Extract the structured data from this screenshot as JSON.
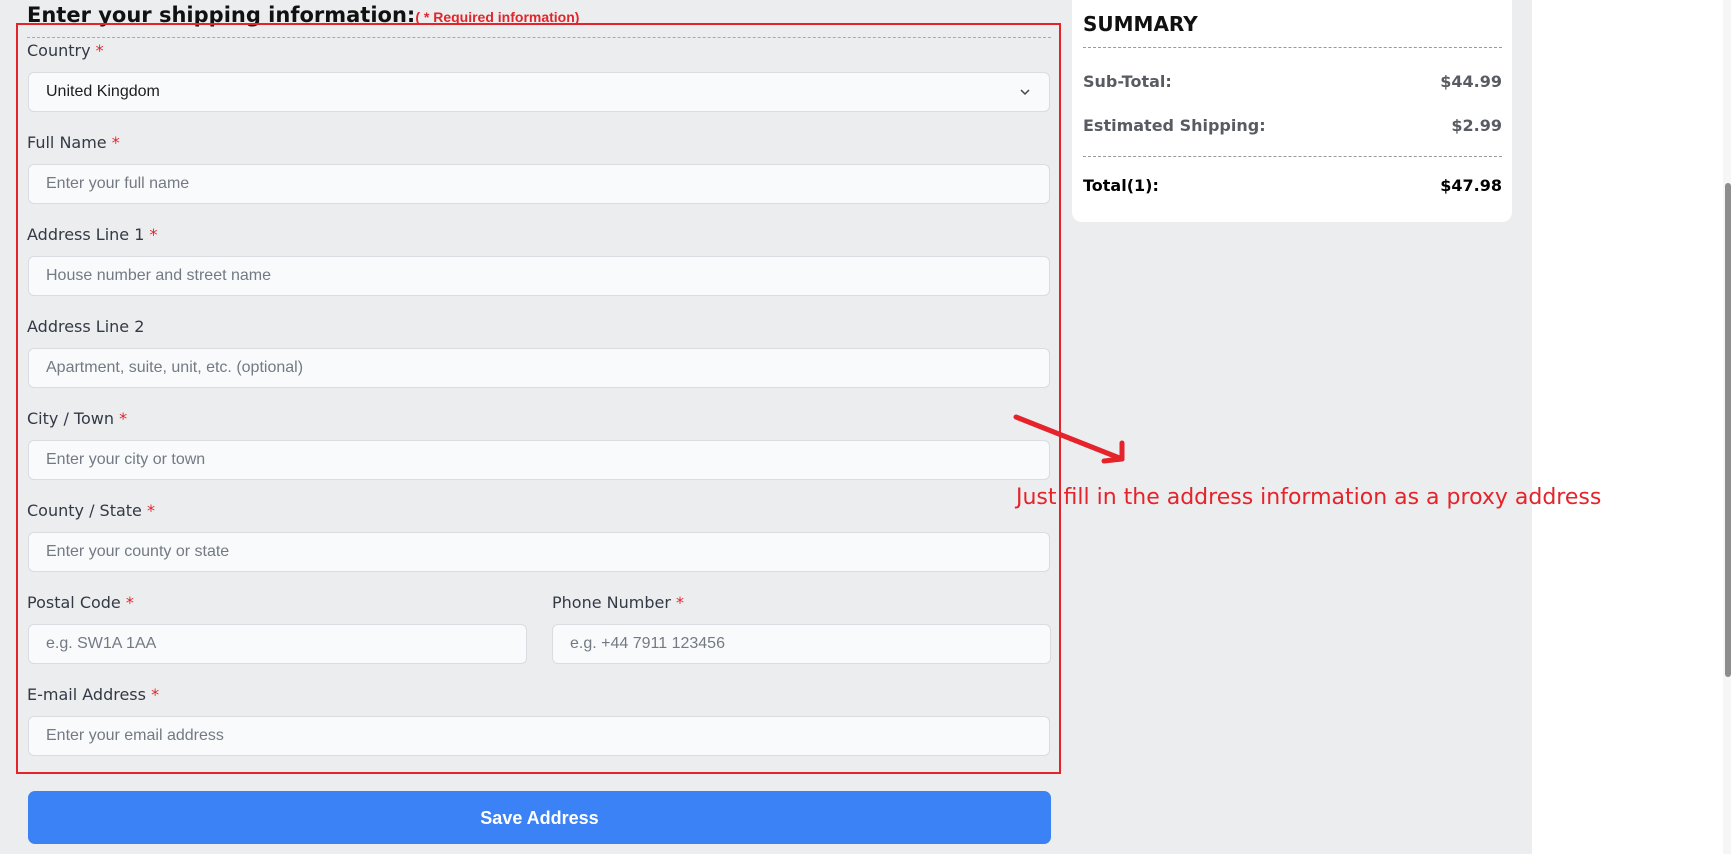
{
  "form": {
    "heading": "Enter your shipping information:",
    "required_note": "( * Required information)",
    "required_star": "*",
    "fields": {
      "country": {
        "label": "Country",
        "value": "United Kingdom"
      },
      "full_name": {
        "label": "Full Name",
        "placeholder": "Enter your full name"
      },
      "address1": {
        "label": "Address Line 1",
        "placeholder": "House number and street name"
      },
      "address2": {
        "label": "Address Line 2",
        "placeholder": "Apartment, suite, unit, etc. (optional)"
      },
      "city": {
        "label": "City / Town",
        "placeholder": "Enter your city or town"
      },
      "county": {
        "label": "County / State",
        "placeholder": "Enter your county or state"
      },
      "postal": {
        "label": "Postal Code",
        "placeholder": "e.g. SW1A 1AA"
      },
      "phone": {
        "label": "Phone Number",
        "placeholder": "e.g. +44 7911 123456"
      },
      "email": {
        "label": "E-mail Address",
        "placeholder": "Enter your email address"
      }
    },
    "save_label": "Save Address"
  },
  "summary": {
    "title": "SUMMARY",
    "subtotal_label": "Sub-Total:",
    "subtotal_value": "$44.99",
    "shipping_label": "Estimated Shipping:",
    "shipping_value": "$2.99",
    "total_label": "Total(1):",
    "total_value": "$47.98"
  },
  "annotation": {
    "text": "Just fill in the address information as a proxy address",
    "color": "#e4232b"
  },
  "colors": {
    "accent": "#3b82f6",
    "required": "#e0262b",
    "background": "#ecedef"
  }
}
